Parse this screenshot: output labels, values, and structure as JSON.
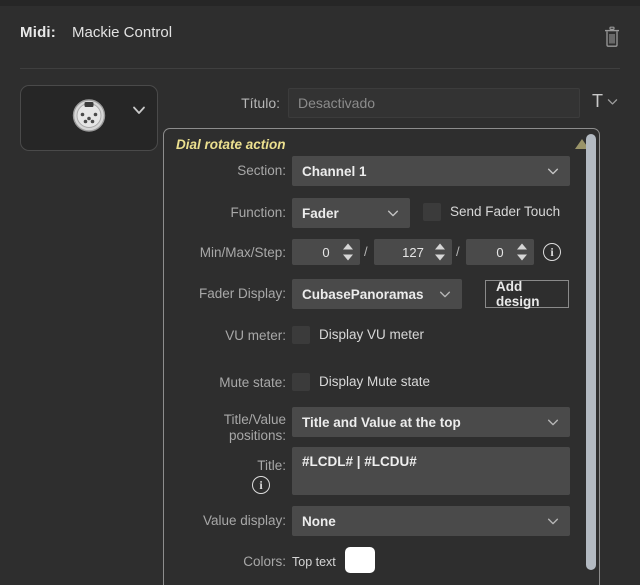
{
  "header": {
    "label": "Midi:",
    "value": "Mackie Control",
    "delete_icon": "trash-icon"
  },
  "device": {
    "icon": "midi-din-connector-icon",
    "chevron": "chevron-down-icon"
  },
  "titulo": {
    "label": "Título:",
    "placeholder": "Desactivado",
    "value": "",
    "format_glyph": "T",
    "format_chevron": "chevron-down-icon"
  },
  "panel": {
    "title": "Dial rotate action",
    "collapse_icon": "triangle-up-icon",
    "accent_color": "#ece08f",
    "collapse_color": "#9a9469",
    "rows": {
      "section": {
        "label": "Section:",
        "value": "Channel 1"
      },
      "function": {
        "label": "Function:",
        "value": "Fader",
        "checkbox_label": "Send Fader Touch",
        "checkbox_checked": false
      },
      "minmaxstep": {
        "label": "Min/Max/Step:",
        "min": "0",
        "max": "127",
        "step": "0",
        "separator": "/",
        "info_icon": "info-icon"
      },
      "fader_display": {
        "label": "Fader Display:",
        "value": "CubasePanoramas",
        "button": "Add design"
      },
      "vu_meter": {
        "label": "VU meter:",
        "checkbox_label": "Display VU meter",
        "checkbox_checked": false
      },
      "mute_state": {
        "label": "Mute state:",
        "checkbox_label": "Display Mute state",
        "checkbox_checked": false
      },
      "title_value_positions": {
        "label_line1": "Title/Value",
        "label_line2": "positions:",
        "value": "Title and Value at the top"
      },
      "title": {
        "label": "Title:",
        "info_icon": "info-icon",
        "value": "#LCDL#  |  #LCDU#"
      },
      "value_display": {
        "label": "Value display:",
        "value": "None"
      },
      "colors": {
        "label": "Colors:",
        "top_text_label": "Top text",
        "top_text_color": "#ffffff"
      }
    }
  },
  "scrollbar": {
    "thumb_color": "#b3bac2"
  }
}
